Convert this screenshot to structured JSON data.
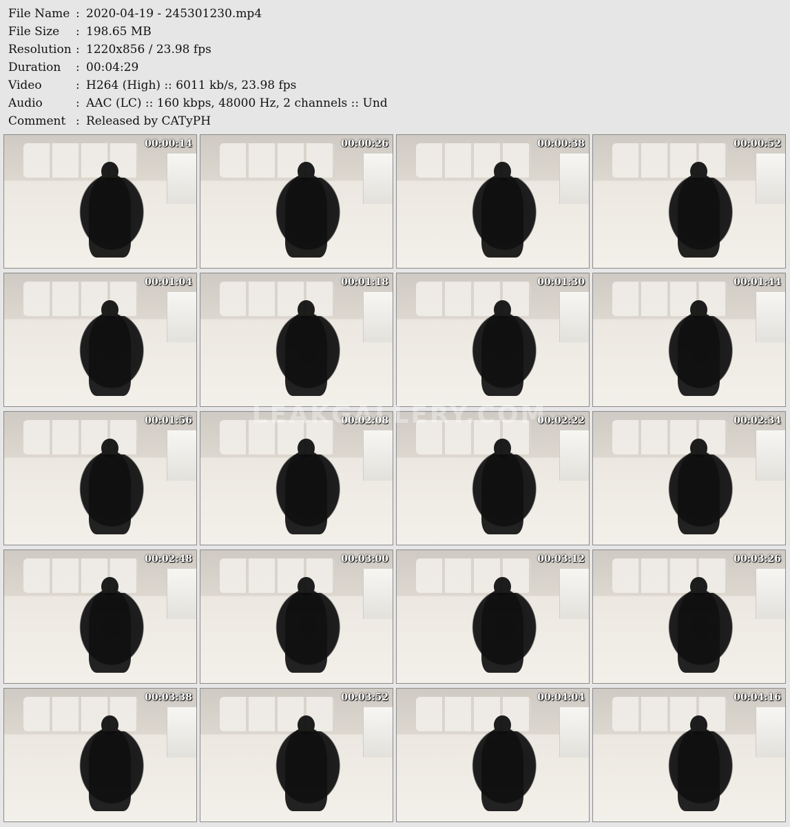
{
  "meta": [
    {
      "label": "File Name",
      "sep": ":",
      "value": "2020-04-19 - 245301230.mp4"
    },
    {
      "label": "File Size",
      "sep": ":",
      "value": "198.65 MB"
    },
    {
      "label": "Resolution",
      "sep": ":",
      "value": "1220x856 / 23.98 fps"
    },
    {
      "label": "Duration",
      "sep": ":",
      "value": "00:04:29"
    },
    {
      "label": "Video",
      "sep": ":",
      "value": "H264 (High) :: 6011 kb/s, 23.98 fps"
    },
    {
      "label": "Audio",
      "sep": ":",
      "value": "AAC (LC) :: 160 kbps, 48000 Hz, 2 channels :: Und"
    },
    {
      "label": "Comment",
      "sep": ":",
      "value": "Released by CATyPH"
    }
  ],
  "thumbnails": [
    "00:00:14",
    "00:00:26",
    "00:00:38",
    "00:00:52",
    "00:01:04",
    "00:01:18",
    "00:01:30",
    "00:01:44",
    "00:01:56",
    "00:02:08",
    "00:02:22",
    "00:02:34",
    "00:02:48",
    "00:03:00",
    "00:03:12",
    "00:03:26",
    "00:03:38",
    "00:03:52",
    "00:04:04",
    "00:04:16"
  ],
  "watermark": "LEAKGALLERY.COM"
}
